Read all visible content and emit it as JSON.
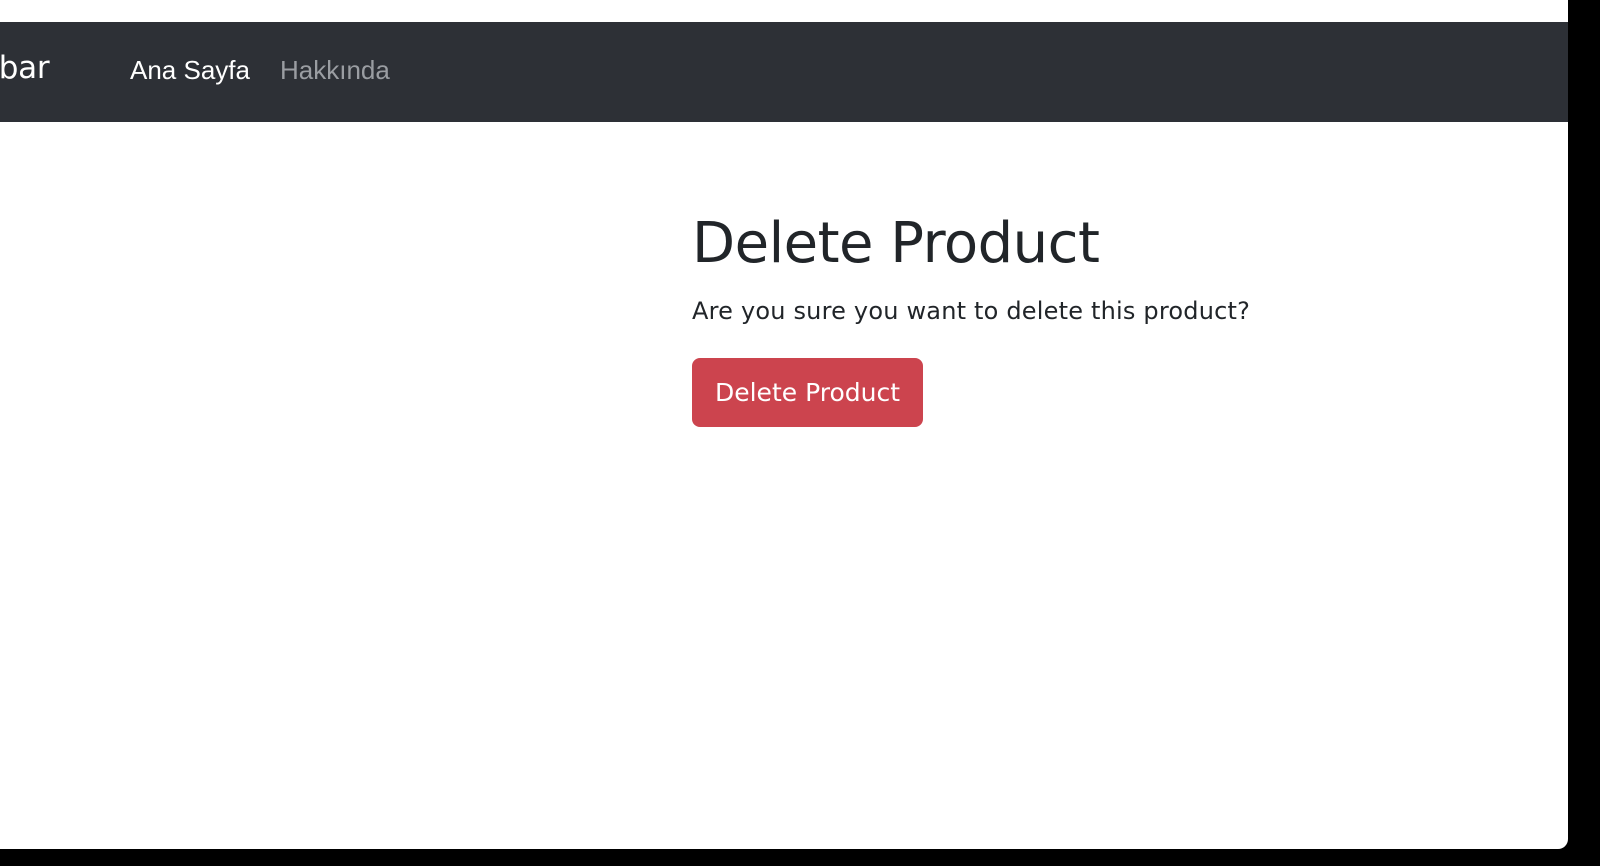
{
  "navbar": {
    "brand": "avbar",
    "links": [
      {
        "label": "Ana Sayfa",
        "active": true
      },
      {
        "label": "Hakkında",
        "active": false
      }
    ],
    "background_color": "#2d3036"
  },
  "main": {
    "title": "Delete Product",
    "message": "Are you sure you want to delete this product?",
    "delete_button_label": "Delete Product",
    "delete_button_color": "#cc444e"
  }
}
